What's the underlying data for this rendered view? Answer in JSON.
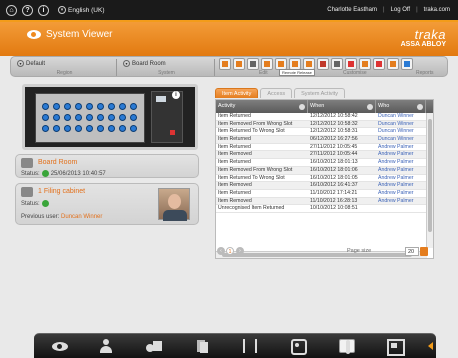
{
  "topbar": {
    "icons": [
      "home-icon",
      "help-icon",
      "info-icon"
    ],
    "language": "English (UK)",
    "user": "Charlotte Eastham",
    "logoff": "Log Off",
    "site": "traka.com"
  },
  "header": {
    "title": "System Viewer",
    "brand": "traka",
    "brand_sub": "ASSA ABLOY"
  },
  "toolbar": {
    "region_value": "Default",
    "region_label": "Region",
    "system_value": "Board Room",
    "system_label": "System",
    "edit_label": "Edit",
    "customise_label": "Customise",
    "reports_label": "Reports",
    "tooltip": "Remote Release"
  },
  "status_cards": {
    "system_name": "Board Room",
    "system_status_label": "Status:",
    "system_status_time": "25/06/2013 10:40:57",
    "cabinet_name": "1 Filing cabinet",
    "cabinet_status_label": "Status:",
    "previous_user_label": "Previous user:",
    "previous_user": "Duncan Winner"
  },
  "tabs": [
    "Item Activity",
    "Access",
    "System Activity"
  ],
  "grid": {
    "columns": [
      "Activity",
      "When",
      "Who"
    ],
    "rows": [
      [
        "Item Returned",
        "12/12/2012 10:58:42",
        "Duncan Winner"
      ],
      [
        "Item Removed From Wrong Slot",
        "12/12/2012 10:58:32",
        "Duncan Winner"
      ],
      [
        "Item Returned To Wrong Slot",
        "12/12/2012 10:58:31",
        "Duncan Winner"
      ],
      [
        "Item Returned",
        "06/12/2012 16:27:56",
        "Duncan Winner"
      ],
      [
        "Item Returned",
        "27/11/2012 10:05:45",
        "Andrew Palmer"
      ],
      [
        "Item Removed",
        "27/11/2012 10:05:44",
        "Andrew Palmer"
      ],
      [
        "Item Returned",
        "16/10/2012 18:01:13",
        "Andrew Palmer"
      ],
      [
        "Item Removed From Wrong Slot",
        "16/10/2012 18:01:06",
        "Andrew Palmer"
      ],
      [
        "Item Returned To Wrong Slot",
        "16/10/2012 18:01:05",
        "Andrew Palmer"
      ],
      [
        "Item Removed",
        "16/10/2012 16:41:37",
        "Andrew Palmer"
      ],
      [
        "Item Returned",
        "11/10/2012 17:14:21",
        "Andrew Palmer"
      ],
      [
        "Item Removed",
        "11/10/2012 16:28:13",
        "Andrew Palmer"
      ],
      [
        "Unrecognised Item Returned",
        "10/10/2012 10:08:51",
        ""
      ]
    ]
  },
  "pager": {
    "current_page": "1",
    "page_size_label": "Page size",
    "page_size": "20"
  },
  "dock": [
    "eye-icon",
    "user-icon",
    "items-icon",
    "documents-icon",
    "brackets-icon",
    "settings-icon",
    "tool-icon",
    "screen-icon"
  ],
  "colors": {
    "accent": "#ef8a1e",
    "topbar": "#1a1a1a",
    "status_ok": "#3aa53a",
    "link": "#3d64b8"
  }
}
